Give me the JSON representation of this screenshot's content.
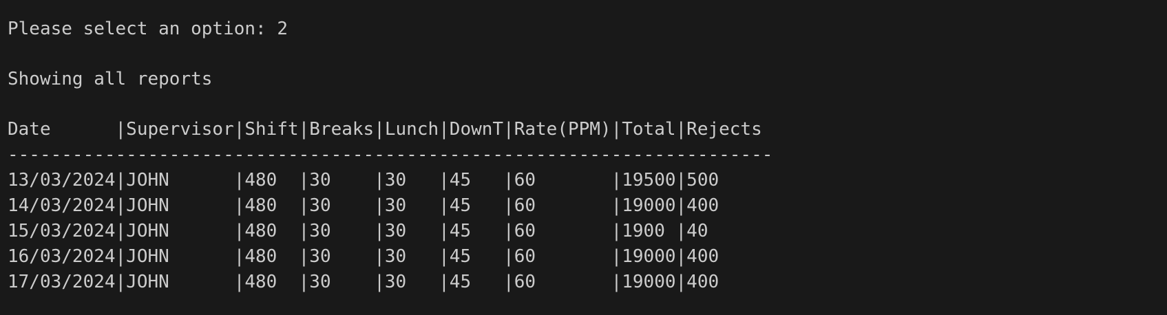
{
  "terminal": {
    "prompt_line": "Please select an option: 2",
    "heading_line": "Showing all reports",
    "table_header": "Date      |Supervisor|Shift|Breaks|Lunch|DownT|Rate(PPM)|Total|Rejects",
    "separator": "-----------------------------------------------------------------------",
    "rows": [
      "13/03/2024|JOHN      |480  |30    |30   |45   |60       |19500|500",
      "14/03/2024|JOHN      |480  |30    |30   |45   |60       |19000|400",
      "15/03/2024|JOHN      |480  |30    |30   |45   |60       |1900 |40",
      "16/03/2024|JOHN      |480  |30    |30   |45   |60       |19000|400",
      "17/03/2024|JOHN      |480  |30    |30   |45   |60       |19000|400"
    ]
  }
}
